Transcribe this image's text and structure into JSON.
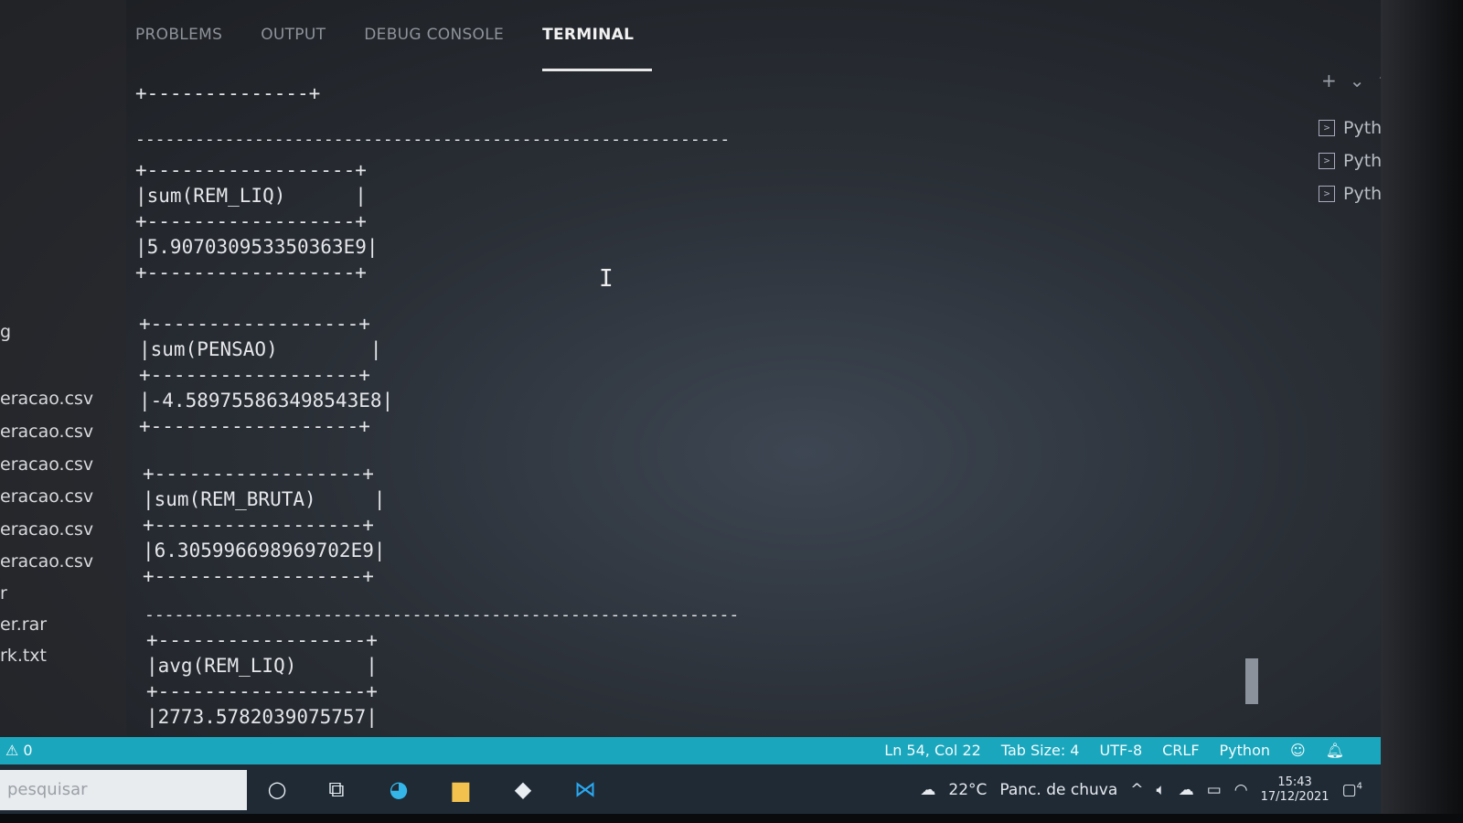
{
  "panel": {
    "tabs": [
      "PROBLEMS",
      "OUTPUT",
      "DEBUG CONSOLE",
      "TERMINAL"
    ]
  },
  "explorer": {
    "files": [
      "g",
      "eracao.csv",
      "eracao.csv",
      "eracao.csv",
      "eracao.csv",
      "eracao.csv",
      "eracao.csv",
      "r",
      "er.rar",
      "rk.txt"
    ]
  },
  "terminal": {
    "top_border": "+--------------+",
    "separator_long": "------------------------------------------------------------",
    "blocks": [
      {
        "border": "+------------------+",
        "header": "|sum(REM_LIQ)      |",
        "value": "|5.907030953350363E9|"
      },
      {
        "border": "+------------------+",
        "header": "|sum(PENSAO)        |",
        "value": "|-4.589755863498543E8|"
      },
      {
        "border": "+------------------+",
        "header": "|sum(REM_BRUTA)     |",
        "value": "|6.305996698969702E9|"
      },
      {
        "border": "+------------------+",
        "header": "|avg(REM_LIQ)      |",
        "value": "|2773.5782039075757|"
      }
    ]
  },
  "terminal_instances": {
    "actions": [
      "+",
      "⌄",
      "^",
      "×"
    ],
    "items": [
      "Python",
      "Python",
      "Python"
    ]
  },
  "statusbar": {
    "warnings": "⚠ 0",
    "position": "Ln 54, Col 22",
    "tab_size": "Tab Size: 4",
    "encoding": "UTF-8",
    "eol": "CRLF",
    "language": "Python"
  },
  "taskbar": {
    "search_placeholder": "pesquisar",
    "weather": "22°C",
    "weather_desc": "Panc. de chuva",
    "time": "15:43",
    "date": "17/12/2021",
    "notification_count": "4"
  },
  "colors": {
    "statusbar": "#1aa7bd",
    "taskbar": "#1f2a35"
  }
}
